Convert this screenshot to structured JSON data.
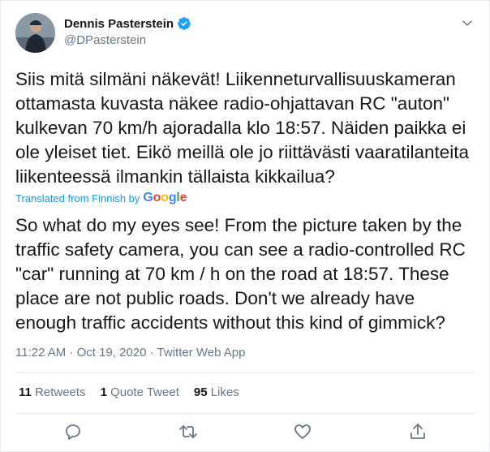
{
  "author": {
    "name": "Dennis Pasterstein",
    "handle": "@DPasterstein",
    "verified": true
  },
  "tweet": {
    "original_text": "Siis mitä silmäni näkevät! Liikenneturvallisuuskameran ottamasta kuvasta näkee radio-ohjattavan RC \"auton\" kulkevan 70 km/h ajoradalla klo 18:57. Näiden paikka ei ole yleiset tiet. Eikö meillä ole jo riittävästi vaaratilanteita liikenteessä ilmankin tällaista kikkailua?",
    "translated_label": "Translated from Finnish by",
    "translator": "Google",
    "translated_text": "So what do my eyes see! From the picture taken by the traffic safety camera, you can see a radio-controlled RC \"car\" running at 70 km / h on the road at 18:57. These place are not public roads. Don't we already have enough traffic accidents without this kind of gimmick?",
    "timestamp": "11:22 AM · Oct 19, 2020 · Twitter Web App"
  },
  "stats": {
    "retweets_count": "11",
    "retweets_label": "Retweets",
    "quote_count": "1",
    "quote_label": "Quote Tweet",
    "likes_count": "95",
    "likes_label": "Likes"
  },
  "actions": [
    "reply-icon",
    "retweet-icon",
    "like-icon",
    "share-icon"
  ],
  "colors": {
    "text": "#14171a",
    "secondary": "#657786",
    "link": "#1b95e0",
    "verified": "#1da1f2",
    "divider": "#e6ecf0"
  }
}
